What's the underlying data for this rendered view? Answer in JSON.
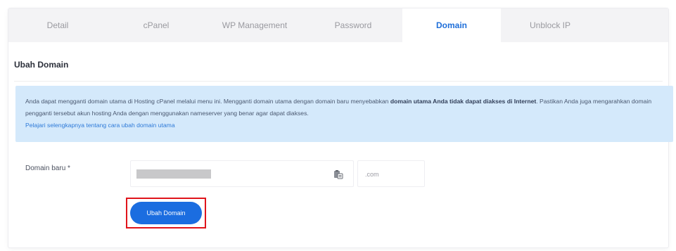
{
  "tabs": [
    {
      "label": "Detail"
    },
    {
      "label": "cPanel"
    },
    {
      "label": "WP Management"
    },
    {
      "label": "Password"
    },
    {
      "label": "Domain"
    },
    {
      "label": "Unblock IP"
    }
  ],
  "active_tab": "Domain",
  "section": {
    "title": "Ubah Domain"
  },
  "info": {
    "text_1": "Anda dapat mengganti domain utama di Hosting cPanel melalui menu ini. Mengganti domain utama dengan domain baru menyebabkan ",
    "bold_1": "domain utama Anda tidak dapat diakses di Internet",
    "text_2": ". Pastikan Anda juga mengarahkan domain pengganti tersebut akun hosting Anda dengan menggunakan nameserver yang benar agar dapat diakses.",
    "link": "Pelajari selengkapnya tentang cara ubah domain utama"
  },
  "form": {
    "domain_label": "Domain baru *",
    "domain_value": "",
    "tld": ".com",
    "submit_label": "Ubah Domain"
  },
  "colors": {
    "accent": "#1b6de0",
    "info_bg": "#d4e9fb",
    "highlight": "#e0141b"
  },
  "icons": {
    "paste": "clipboard-paste-icon"
  }
}
